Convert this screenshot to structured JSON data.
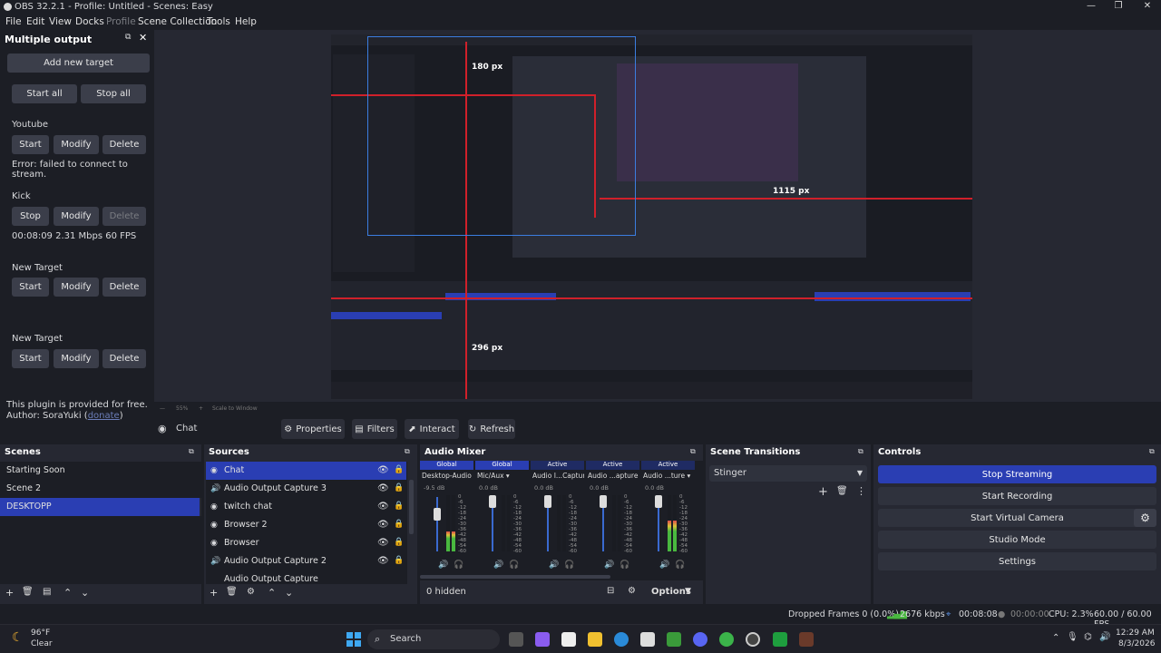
{
  "window": {
    "title": "OBS 32.2.1 - Profile: Untitled - Scenes: Easy",
    "buttons": [
      "—",
      "❐",
      "✕"
    ]
  },
  "menu": [
    "File",
    "Edit",
    "View",
    "Docks",
    "Profile",
    "Scene Collection",
    "Tools",
    "Help"
  ],
  "multiple_output": {
    "title": "Multiple output",
    "add_target": "Add new target",
    "start_all": "Start all",
    "stop_all": "Stop all",
    "targets": [
      {
        "name": "Youtube",
        "primary": "Start",
        "modify": "Modify",
        "delete": "Delete",
        "status": "Error: failed to connect to stream.",
        "delete_disabled": false
      },
      {
        "name": "Kick",
        "primary": "Stop",
        "modify": "Modify",
        "delete": "Delete",
        "status": "00:08:09  2.31 Mbps  60 FPS",
        "delete_disabled": true
      },
      {
        "name": "New Target",
        "primary": "Start",
        "modify": "Modify",
        "delete": "Delete",
        "status": "",
        "delete_disabled": false
      },
      {
        "name": "New Target",
        "primary": "Start",
        "modify": "Modify",
        "delete": "Delete",
        "status": "",
        "delete_disabled": false
      }
    ],
    "footer_text": "This plugin is provided for free.",
    "author_prefix": "Author: SoraYuki (",
    "author_link": "donate",
    "author_suffix": ")"
  },
  "preview": {
    "annotations": [
      "180 px",
      "1115 px",
      "296 px"
    ],
    "zoom_text": "55%",
    "scale_text": "Scale to Window"
  },
  "source_toolbar": {
    "selected_source": "Chat",
    "properties": "Properties",
    "filters": "Filters",
    "interact": "Interact",
    "refresh": "Refresh"
  },
  "scenes": {
    "title": "Scenes",
    "items": [
      "Starting Soon",
      "Scene 2",
      "DESKTOPP"
    ],
    "selected_index": 2
  },
  "sources": {
    "title": "Sources",
    "items": [
      "Chat",
      "Audio Output Capture 3",
      "twitch chat",
      "Browser 2",
      "Browser",
      "Audio Output Capture 2",
      "Audio Output Capture"
    ],
    "selected_index": 0
  },
  "audio_mixer": {
    "title": "Audio Mixer",
    "channels": [
      {
        "tag": "Global",
        "name": "Desktop-Audio",
        "db": "-9.5 dB",
        "level": 0.35
      },
      {
        "tag": "Global",
        "name": "Mic/Aux",
        "db": "0.0 dB",
        "level": 0.0
      },
      {
        "tag": "Active",
        "name": "Audio I...Capture",
        "db": "0.0 dB",
        "level": 0.0
      },
      {
        "tag": "Active",
        "name": "Audio ...apture",
        "db": "0.0 dB",
        "level": 0.0
      },
      {
        "tag": "Active",
        "name": "Audio ...ture",
        "db": "0.0 dB",
        "level": 0.55
      }
    ],
    "scale": [
      "0",
      "-6",
      "-12",
      "-18",
      "-24",
      "-30",
      "-36",
      "-42",
      "-48",
      "-54",
      "-60"
    ],
    "hidden": "0 hidden",
    "options": "Options"
  },
  "transitions": {
    "title": "Scene Transitions",
    "selected": "Stinger"
  },
  "controls": {
    "title": "Controls",
    "stop_streaming": "Stop Streaming",
    "start_recording": "Start Recording",
    "start_virtual_camera": "Start Virtual Camera",
    "studio_mode": "Studio Mode",
    "settings": "Settings"
  },
  "status_bar": {
    "dropped": "Dropped Frames 0 (0.0%)",
    "bitrate": "2676 kbps",
    "stream_time": "00:08:08",
    "rec_time": "00:00:00",
    "cpu": "CPU: 2.3%",
    "fps": "60.00 / 60.00 FPS"
  },
  "taskbar": {
    "weather_temp": "96°F",
    "weather_desc": "Clear",
    "search": "Search",
    "time": "12:29 AM",
    "date": "8/3/2026"
  },
  "colors": {
    "accent": "#2a3eb3",
    "panel": "#262832",
    "background": "#1c1e25",
    "button": "#3b3e4a",
    "annotation_red": "#d0202a"
  }
}
